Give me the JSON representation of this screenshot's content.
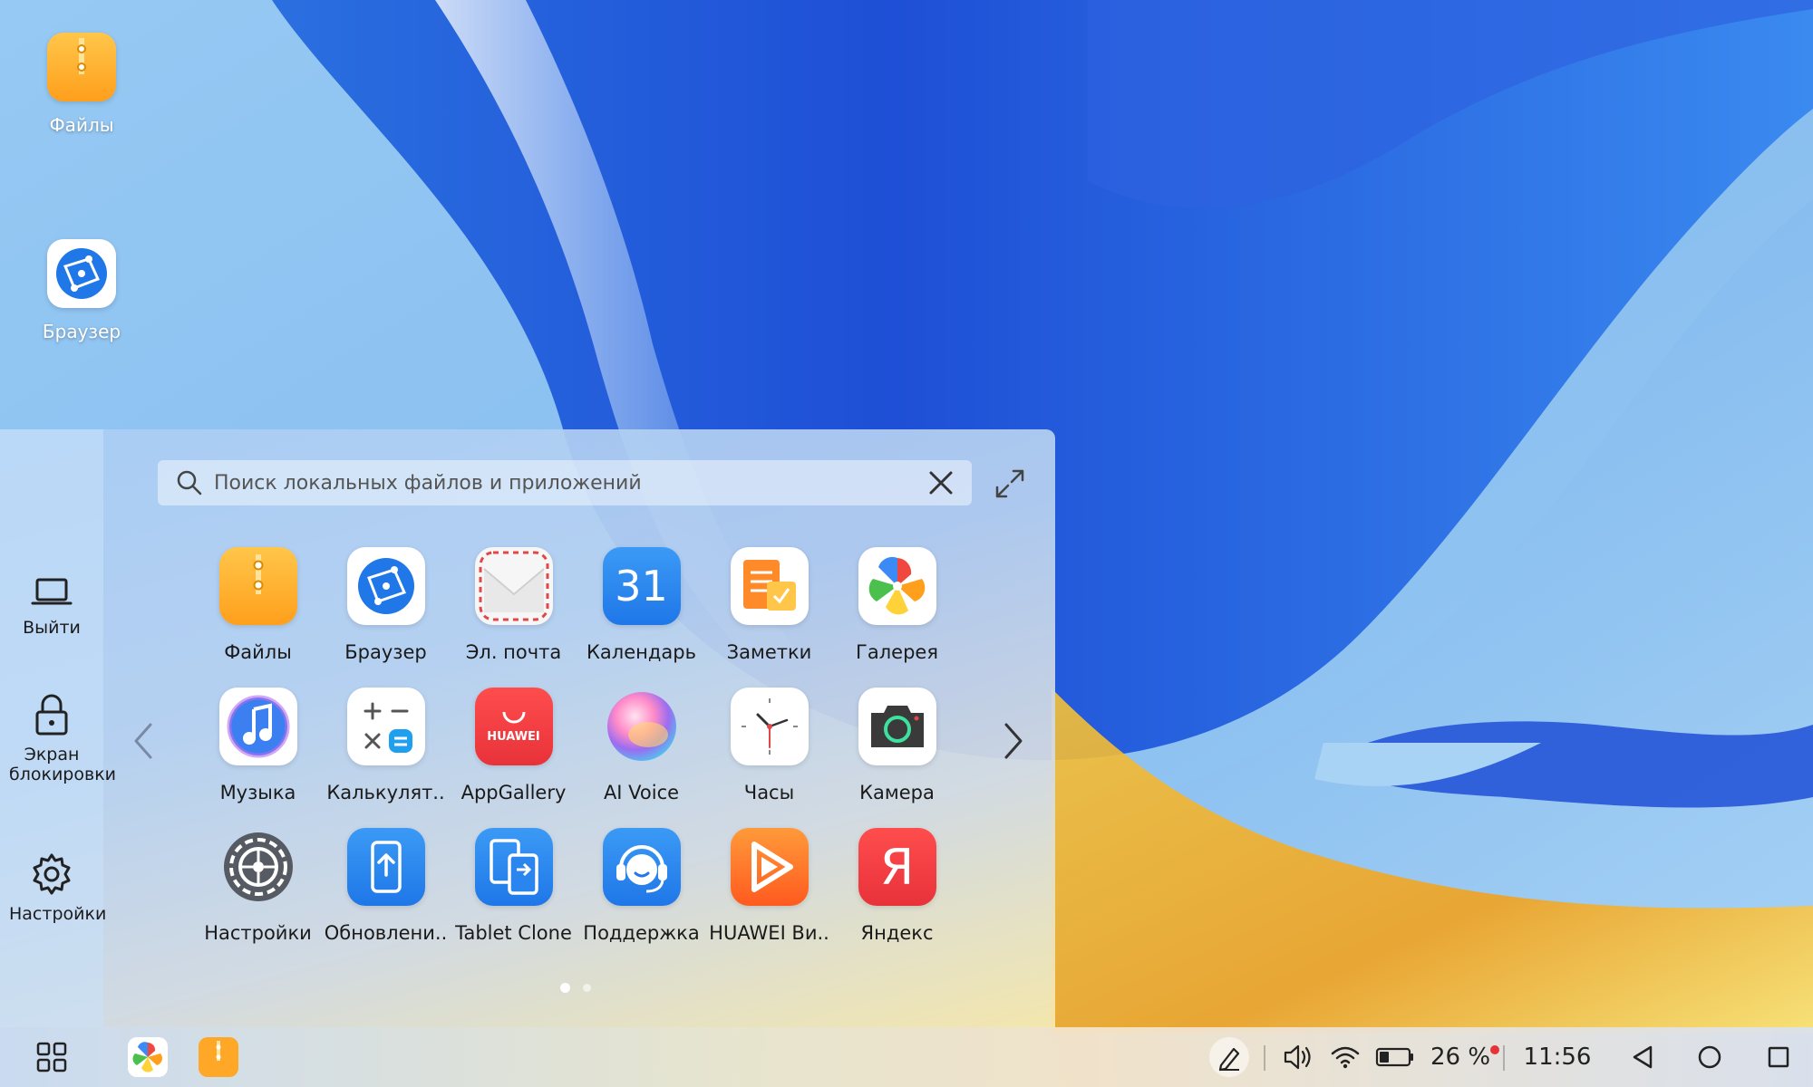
{
  "desktop": {
    "icons": [
      {
        "label": "Файлы",
        "icon": "files-icon"
      },
      {
        "label": "Браузер",
        "icon": "browser-icon"
      }
    ]
  },
  "start_menu": {
    "search": {
      "placeholder": "Поиск локальных файлов и приложений",
      "value": ""
    },
    "sidebar": [
      {
        "label": "Выйти",
        "icon": "laptop-icon"
      },
      {
        "label": "Экран блокировки",
        "icon": "lock-icon"
      },
      {
        "label": "Настройки",
        "icon": "gear-icon"
      }
    ],
    "apps": [
      {
        "label": "Файлы",
        "icon": "files-icon"
      },
      {
        "label": "Браузер",
        "icon": "browser-icon"
      },
      {
        "label": "Эл. почта",
        "icon": "mail-icon"
      },
      {
        "label": "Календарь",
        "icon": "calendar-icon",
        "badge": "31"
      },
      {
        "label": "Заметки",
        "icon": "notes-icon"
      },
      {
        "label": "Галерея",
        "icon": "gallery-icon"
      },
      {
        "label": "Музыка",
        "icon": "music-icon"
      },
      {
        "label": "Калькулят..",
        "icon": "calculator-icon"
      },
      {
        "label": "AppGallery",
        "icon": "appgallery-icon",
        "badge": "HUAWEI"
      },
      {
        "label": "AI Voice",
        "icon": "ai-voice-icon"
      },
      {
        "label": "Часы",
        "icon": "clock-icon"
      },
      {
        "label": "Камера",
        "icon": "camera-icon"
      },
      {
        "label": "Настройки",
        "icon": "settings-icon"
      },
      {
        "label": "Обновлени..",
        "icon": "update-icon"
      },
      {
        "label": "Tablet Clone",
        "icon": "tablet-clone-icon"
      },
      {
        "label": "Поддержка",
        "icon": "support-icon"
      },
      {
        "label": "HUAWEI Ви..",
        "icon": "huawei-video-icon"
      },
      {
        "label": "Яндекс",
        "icon": "yandex-icon",
        "badge": "Я"
      }
    ],
    "pages": {
      "count": 2,
      "current": 1
    }
  },
  "taskbar": {
    "battery": "26 %",
    "time": "11:56"
  },
  "colors": {
    "accent_blue": "#1f77e8",
    "files_orange": "#ffa726",
    "yandex_red": "#e8323a"
  }
}
